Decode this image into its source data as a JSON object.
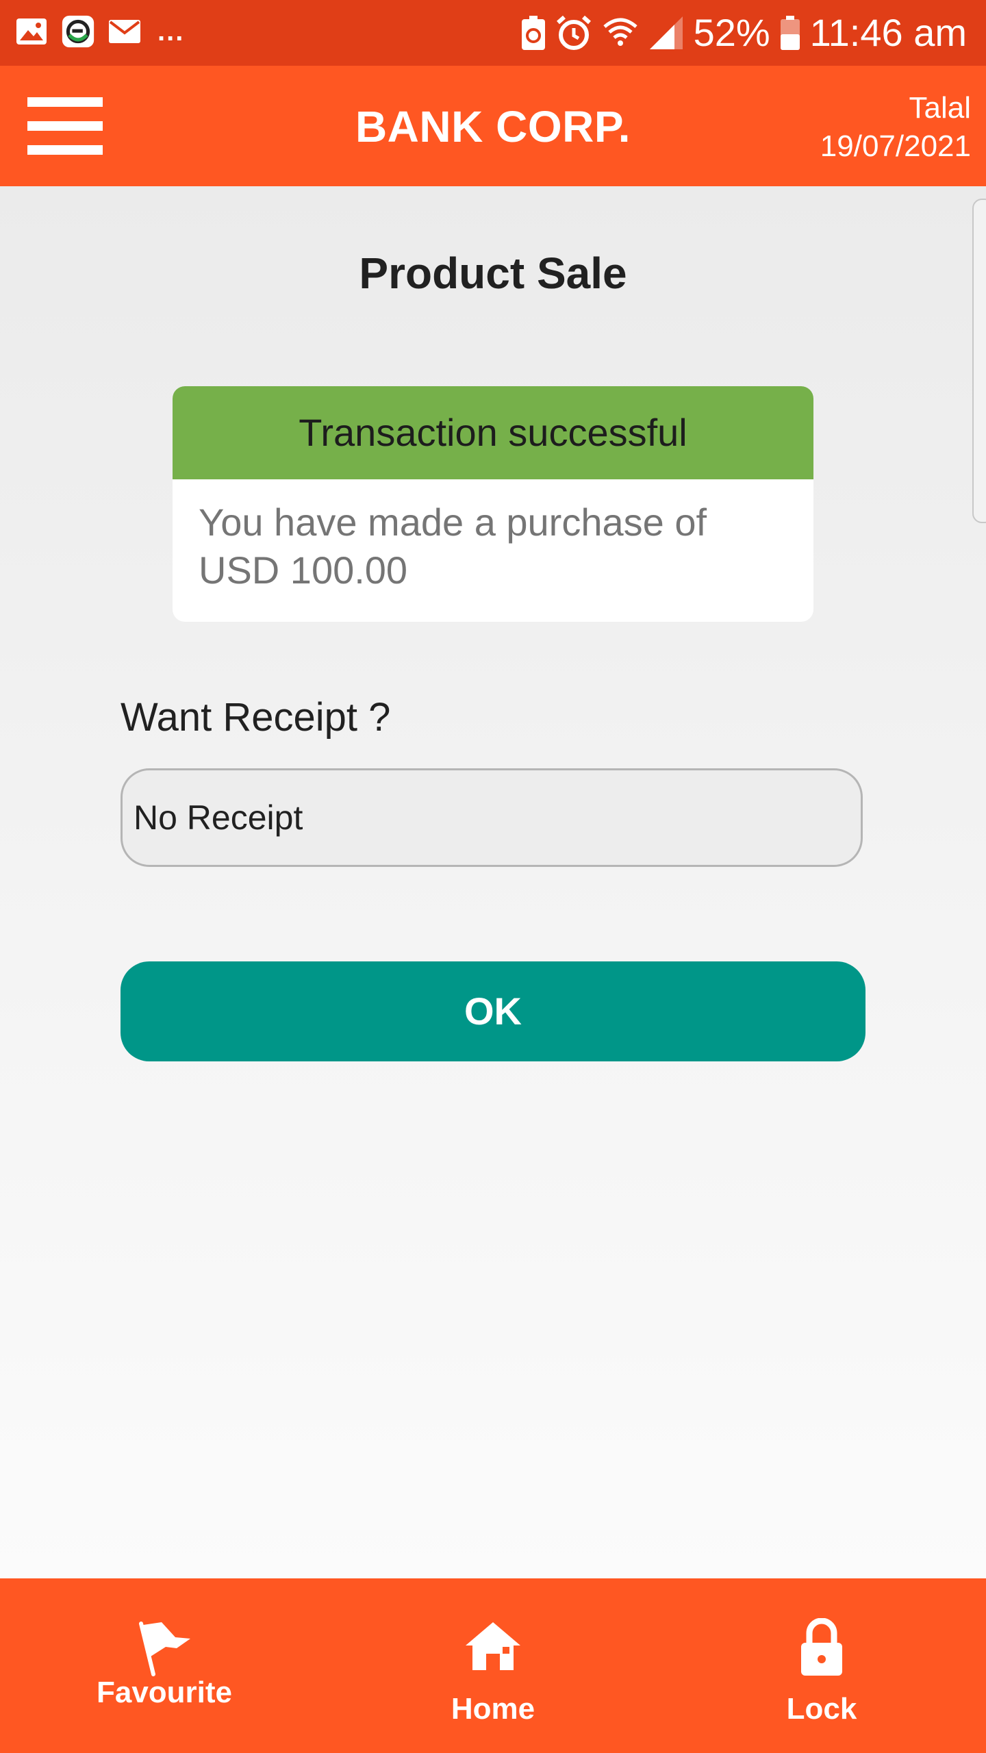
{
  "status_bar": {
    "left_icons": [
      "gallery-icon",
      "app-notification-icon",
      "mail-icon"
    ],
    "more": "...",
    "battery_percent": "52%",
    "time": "11:46 am",
    "right_icons": [
      "battery-saver-icon",
      "alarm-icon",
      "wifi-icon",
      "signal-icon",
      "battery-icon"
    ]
  },
  "header": {
    "menu_icon": "hamburger-menu-icon",
    "title": "BANK CORP.",
    "user": "Talal",
    "date": "19/07/2021"
  },
  "main": {
    "title": "Product Sale",
    "alert": {
      "title": "Transaction successful",
      "message": "You have made a purchase of USD 100.00"
    },
    "receipt": {
      "label": "Want Receipt ?",
      "selected": "No Receipt"
    },
    "ok_label": "OK"
  },
  "bottom_nav": {
    "items": [
      {
        "label": "Favourite",
        "icon": "flag-icon"
      },
      {
        "label": "Home",
        "icon": "home-icon"
      },
      {
        "label": "Lock",
        "icon": "lock-icon"
      }
    ]
  },
  "colors": {
    "status_bar": "#e03e17",
    "brand": "#ff5722",
    "success": "#76b04a",
    "ok_button": "#009688"
  }
}
